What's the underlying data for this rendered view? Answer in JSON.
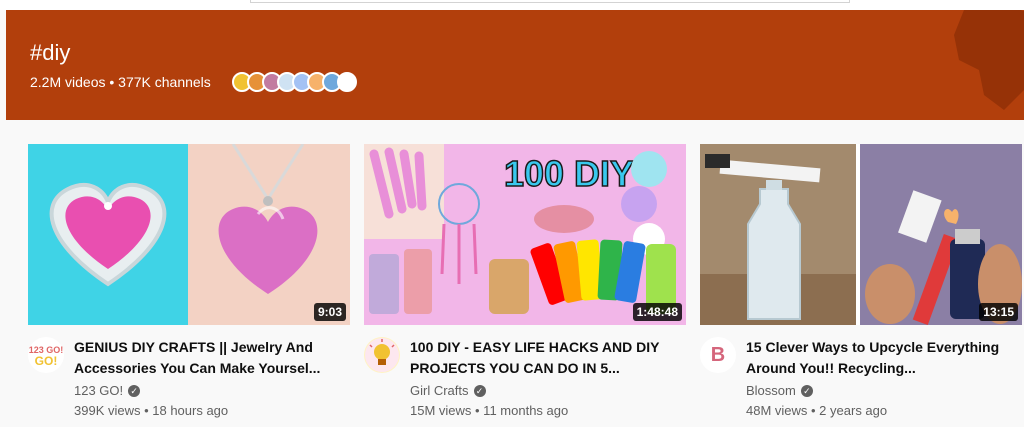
{
  "hashtag": {
    "title": "#diy",
    "stats": "2.2M videos • 377K channels",
    "banner_color": "#b23f0c"
  },
  "videos": [
    {
      "title": "GENIUS DIY CRAFTS || Jewelry And Accessories You Can Make Yoursel...",
      "channel": "123 GO!",
      "views": "399K views • 18 hours ago",
      "duration": "9:03",
      "avatar_text": "123 GO!"
    },
    {
      "title": "100 DIY - EASY LIFE HACKS AND DIY PROJECTS YOU CAN DO IN 5...",
      "channel": "Girl Crafts",
      "views": "15M views • 11 months ago",
      "duration": "1:48:48",
      "thumb_text": "100 DIY"
    },
    {
      "title": "15 Clever Ways to Upcycle Everything Around You!! Recycling...",
      "channel": "Blossom",
      "views": "48M views • 2 years ago",
      "duration": "13:15",
      "avatar_text": "B"
    }
  ]
}
